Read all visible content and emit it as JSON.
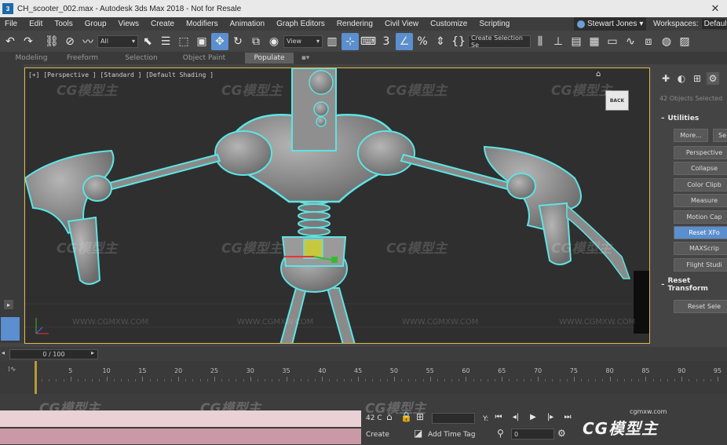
{
  "window": {
    "title": "CH_scooter_002.max - Autodesk 3ds Max 2018 - Not for Resale",
    "close_glyph": "✕",
    "app_icon_glyph": "3"
  },
  "menu": {
    "items": [
      "File",
      "Edit",
      "Tools",
      "Group",
      "Views",
      "Create",
      "Modifiers",
      "Animation",
      "Graph Editors",
      "Rendering",
      "Civil View",
      "Customize",
      "Scripting"
    ],
    "user_name": "Stewart Jones",
    "workspaces_label": "Workspaces:",
    "workspaces_value": "Default"
  },
  "toolbar": {
    "filter_value": "All",
    "refcoord_value": "View",
    "named_sel_value": "Create Selection Se",
    "snap_label": "3",
    "icons": [
      "undo-icon",
      "redo-icon",
      "link-icon",
      "unlink-icon",
      "bind-space-warp-icon",
      "select-object-icon",
      "select-by-name-icon",
      "rect-region-icon",
      "window-crossing-icon",
      "select-move-icon",
      "select-rotate-icon",
      "select-scale-icon",
      "select-place-icon"
    ]
  },
  "ribbon": {
    "tabs": [
      "Modeling",
      "Freeform",
      "Selection",
      "Object Paint",
      "Populate"
    ],
    "selected": "Populate"
  },
  "viewport": {
    "label": "[+] [Perspective ] [Standard ] [Default Shading ]",
    "viewcube_face": "BACK",
    "watermark_text": "CG模型主",
    "watermark_url": "WWW.CGMXW.COM",
    "colors": {
      "background": "#2f2f2f",
      "border": "#e0b84a",
      "selection_outline": "#5fe3e3",
      "model_gray": "#8a8a8a"
    }
  },
  "command_panel": {
    "objects_selected": "42 Objects Selected",
    "utilities_title": "Utilities",
    "more_label": "More...",
    "sets_label": "Se",
    "buttons": [
      "Perspective",
      "Collapse",
      "Color Clipb",
      "Measure",
      "Motion Cap",
      "Reset XFo",
      "MAXScrip",
      "Flight Studi"
    ],
    "selected_button": "Reset XFo",
    "reset_transform_title": "Reset Transform",
    "reset_selected_label": "Reset Sele"
  },
  "time_slider": {
    "label": "0 / 100"
  },
  "track_bar": {
    "ruler_labels": [
      "5",
      "10",
      "15",
      "20",
      "25",
      "30",
      "35",
      "40",
      "45",
      "50",
      "55",
      "60",
      "65",
      "70",
      "75",
      "80",
      "85",
      "90",
      "95"
    ],
    "current_frame": 0
  },
  "status": {
    "selected_count": "42 C",
    "add_time_tag": "Add Time Tag",
    "create_label": "Create",
    "x_label": "Y:",
    "frame_field": "0",
    "watermark_url": "cgmxw.com",
    "watermark_logo": "CG模型主"
  }
}
